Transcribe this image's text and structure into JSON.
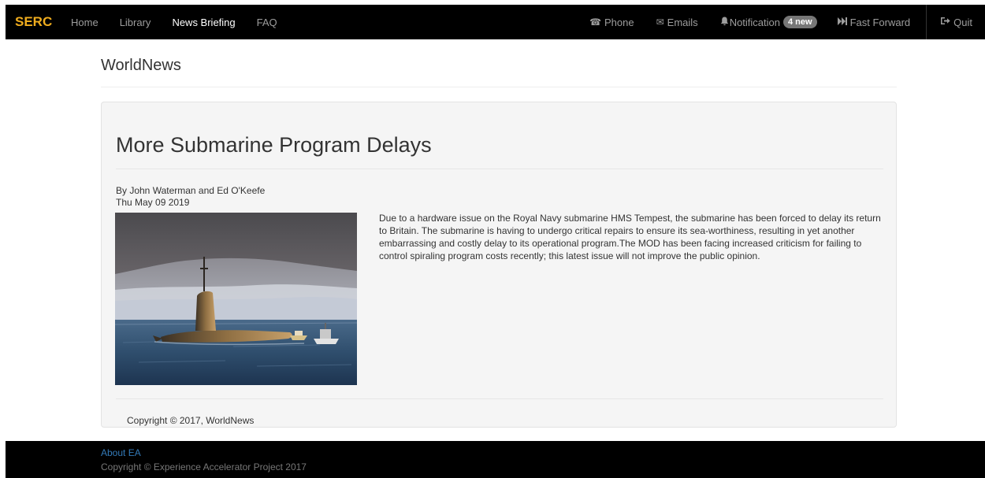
{
  "navbar": {
    "brand": "SERC",
    "links": [
      "Home",
      "Library",
      "News Briefing",
      "FAQ"
    ],
    "active": "News Briefing",
    "phone": "Phone",
    "emails": "Emails",
    "notification": "Notification",
    "notification_badge": "4 new",
    "fast_forward": "Fast Forward",
    "quit": "Quit",
    "icons": {
      "phone": "phone-icon",
      "emails": "envelope-icon",
      "notification": "bell-icon",
      "fast_forward": "fast-forward-icon",
      "quit": "log-out-icon"
    }
  },
  "page": {
    "title": "WorldNews"
  },
  "article": {
    "headline": "More Submarine Program Delays",
    "author": "By John Waterman and Ed O'Keefe",
    "date": "Thu May 09 2019",
    "body": "Due to a hardware issue on the Royal Navy submarine HMS Tempest, the submarine has been forced to delay its return to Britain. The submarine is having to undergo critical repairs to ensure its sea-worthiness, resulting in yet another embarrassing and costly delay to its operational program.The MOD has been facing increased criticism for failing to control spiraling program costs recently; this latest issue will not improve the public opinion.",
    "copyright": "Copyright © 2017, WorldNews"
  },
  "footer": {
    "link": "About EA",
    "copyright": "Copyright © Experience Accelerator Project 2017"
  },
  "colors": {
    "brand": "#f0ad1e",
    "navbar_bg": "#000000",
    "nav_link": "#9d9d9d",
    "nav_active": "#ffffff",
    "badge_bg": "#777777",
    "well_bg": "#f5f5f5",
    "footer_link": "#337ab7"
  }
}
